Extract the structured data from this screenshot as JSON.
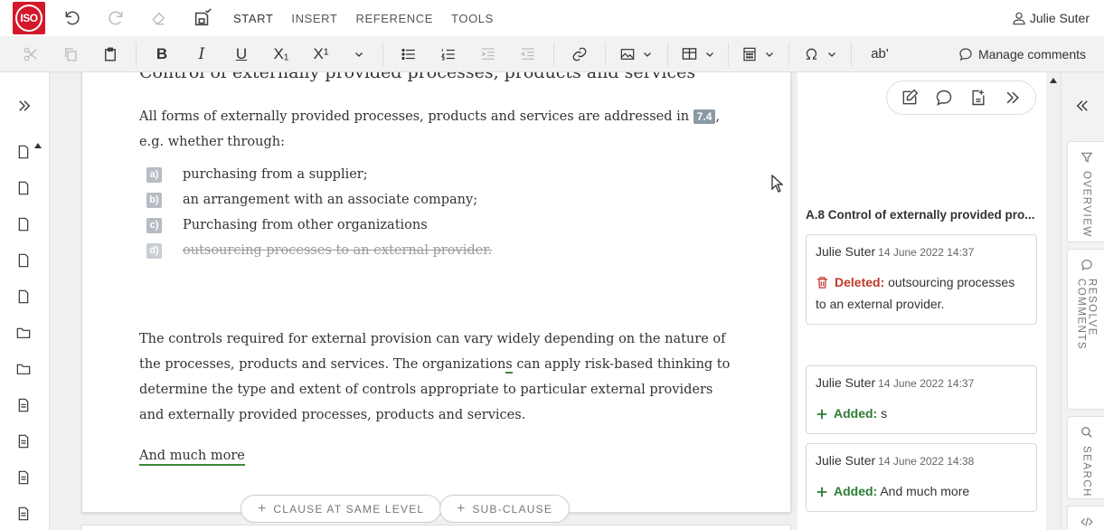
{
  "app": {
    "logo_text": "ISO"
  },
  "menu": {
    "tabs": [
      {
        "label": "START"
      },
      {
        "label": "INSERT"
      },
      {
        "label": "REFERENCE"
      },
      {
        "label": "TOOLS"
      }
    ],
    "user_name": "Julie Suter"
  },
  "toolbar": {
    "bold": "B",
    "italic": "I",
    "underline": "U",
    "subscript": "X₁",
    "superscript": "X¹",
    "abbr": "ab'",
    "manage_comments": "Manage comments"
  },
  "document": {
    "heading": "Control of externally provided processes, products and services",
    "para1_before": "All forms of externally provided processes, products and services are addressed in ",
    "para1_ref": "7.4",
    "para1_after": ", e.g. whether through:",
    "list": [
      {
        "label": "a)",
        "text": "purchasing from a supplier;",
        "deleted": false
      },
      {
        "label": "b)",
        "text": "an arrangement with an associate company;",
        "deleted": false
      },
      {
        "label": "c)",
        "text": "Purchasing from other organizations",
        "deleted": false
      },
      {
        "label": "d)",
        "text": "outsourcing processes to an external provider.",
        "deleted": true
      }
    ],
    "para2_before": "The controls required for external provision can vary widely depending on the nature of the processes, products and services. The organization",
    "para2_added": "s",
    "para2_after": " can apply risk-based thinking to determine the type and extent of controls appropriate to particular external providers and externally provided processes, products and services.",
    "more": "And much more",
    "add_same_level": "CLAUSE AT SAME LEVEL",
    "add_sub_clause": "SUB-CLAUSE"
  },
  "comments": {
    "section_title": "A.8 Control of externally provided pro...",
    "cards": [
      {
        "author": "Julie Suter",
        "date": "14 June 2022 14:37",
        "kind": "Deleted:",
        "text": "outsourcing processes to an external provider."
      },
      {
        "author": "Julie Suter",
        "date": "14 June 2022 14:37",
        "kind": "Added:",
        "text": "s"
      },
      {
        "author": "Julie Suter",
        "date": "14 June 2022 14:38",
        "kind": "Added:",
        "text": "And much more"
      }
    ]
  },
  "side_tabs": [
    {
      "label": "OVERVIEW"
    },
    {
      "label": "RESOLVE COMMENTS"
    },
    {
      "label": "SEARCH"
    }
  ],
  "colors": {
    "brand": "#d4172a",
    "deleted": "#c0392b",
    "added": "#2e7d32"
  }
}
